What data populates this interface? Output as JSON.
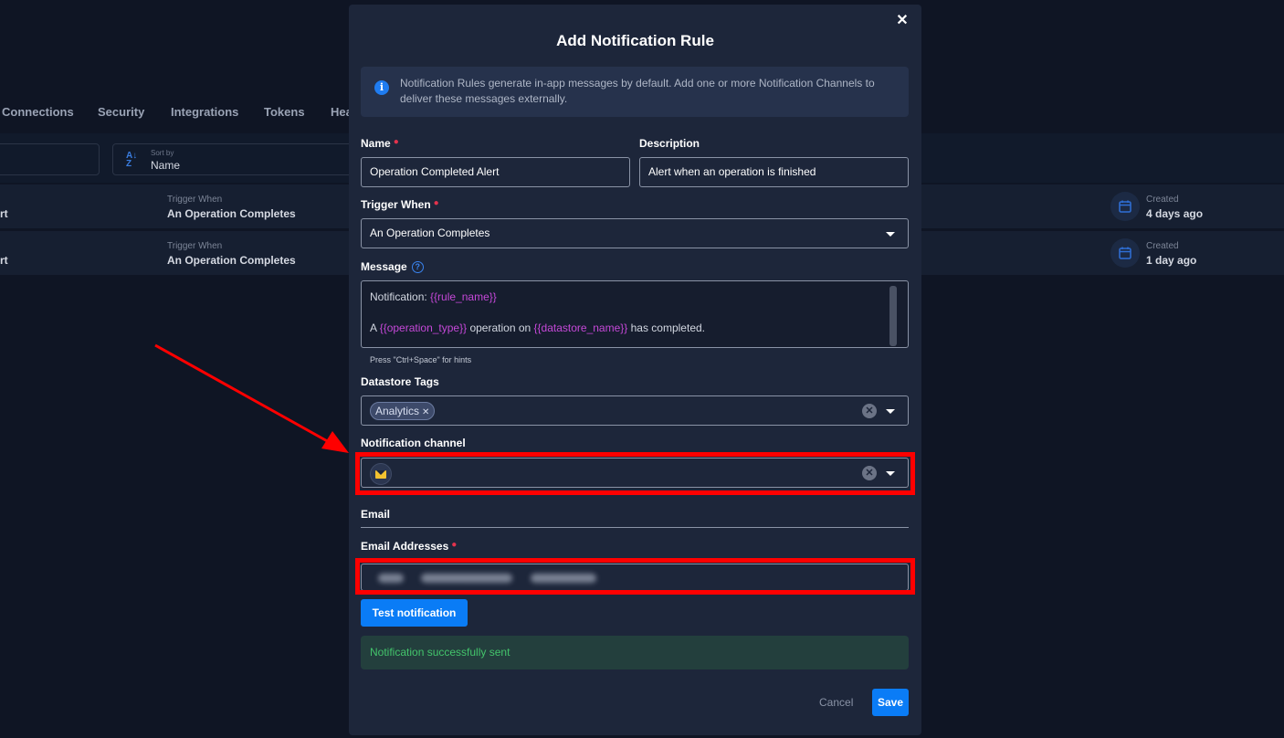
{
  "background": {
    "tabs": [
      "Connections",
      "Security",
      "Integrations",
      "Tokens",
      "Hea"
    ],
    "sort": {
      "sub_label": "Sort by",
      "value": "Name"
    },
    "rows": [
      {
        "name_trunc": "rt",
        "trigger_label": "Trigger When",
        "trigger_value": "An Operation Completes",
        "created_label": "Created",
        "created_value": "4 days ago"
      },
      {
        "name_trunc": "rt",
        "trigger_label": "Trigger When",
        "trigger_value": "An Operation Completes",
        "created_label": "Created",
        "created_value": "1 day ago"
      }
    ]
  },
  "modal": {
    "title": "Add Notification Rule",
    "close_icon": "close-icon",
    "info_text": "Notification Rules generate in-app messages by default. Add one or more Notification Channels to deliver these messages externally.",
    "name": {
      "label": "Name",
      "value": "Operation Completed Alert"
    },
    "description": {
      "label": "Description",
      "value": "Alert when an operation is finished"
    },
    "trigger": {
      "label": "Trigger When",
      "value": "An Operation Completes"
    },
    "message": {
      "label": "Message",
      "line1_prefix": "Notification: ",
      "line1_var": "{{rule_name}}",
      "line2_a": "A ",
      "line2_var1": "{{operation_type}}",
      "line2_b": " operation on ",
      "line2_var2": "{{datastore_name}}",
      "line2_c": " has completed.",
      "hint": "Press \"Ctrl+Space\" for hints"
    },
    "datastore_tags": {
      "label": "Datastore Tags",
      "tags": [
        "Analytics"
      ]
    },
    "notification_channel": {
      "label": "Notification channel",
      "icon": "mail-icon"
    },
    "email_section": "Email",
    "email_addresses": {
      "label": "Email Addresses"
    },
    "test_button": "Test notification",
    "success_message": "Notification successfully sent",
    "cancel_label": "Cancel",
    "save_label": "Save"
  },
  "colors": {
    "accent": "#0a7cf6",
    "required": "#e3334d",
    "template_variable": "#c548d8",
    "highlight": "#ff0000",
    "success": "#43c46b"
  }
}
